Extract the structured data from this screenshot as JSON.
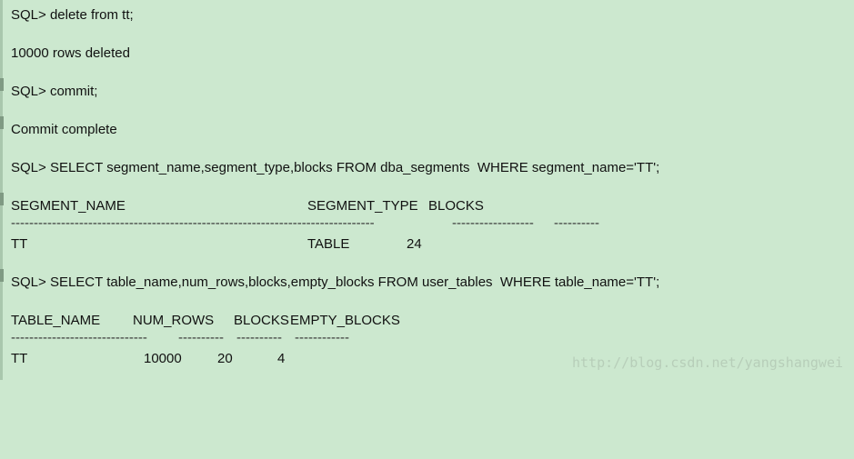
{
  "console": {
    "lines": [
      "SQL> delete from tt;",
      "10000 rows deleted",
      "SQL> commit;",
      "Commit complete",
      "SQL> SELECT segment_name,segment_type,blocks FROM dba_segments  WHERE segment_name='TT';",
      "SQL> SELECT table_name,num_rows,blocks,empty_blocks FROM user_tables  WHERE table_name='TT';"
    ],
    "segments": {
      "headers": [
        "SEGMENT_NAME",
        "SEGMENT_TYPE",
        "BLOCKS"
      ],
      "separators": [
        "--------------------------------------------------------------------------------",
        "------------------",
        "----------"
      ],
      "row": [
        "TT",
        "TABLE",
        "24"
      ]
    },
    "tables": {
      "headers": [
        "TABLE_NAME",
        "NUM_ROWS",
        "BLOCKS",
        "EMPTY_BLOCKS"
      ],
      "separators": [
        "------------------------------",
        "----------",
        "----------",
        "------------"
      ],
      "row": [
        "TT",
        "10000",
        "20",
        "4"
      ]
    }
  },
  "watermark": "http://blog.csdn.net/yangshangwei"
}
